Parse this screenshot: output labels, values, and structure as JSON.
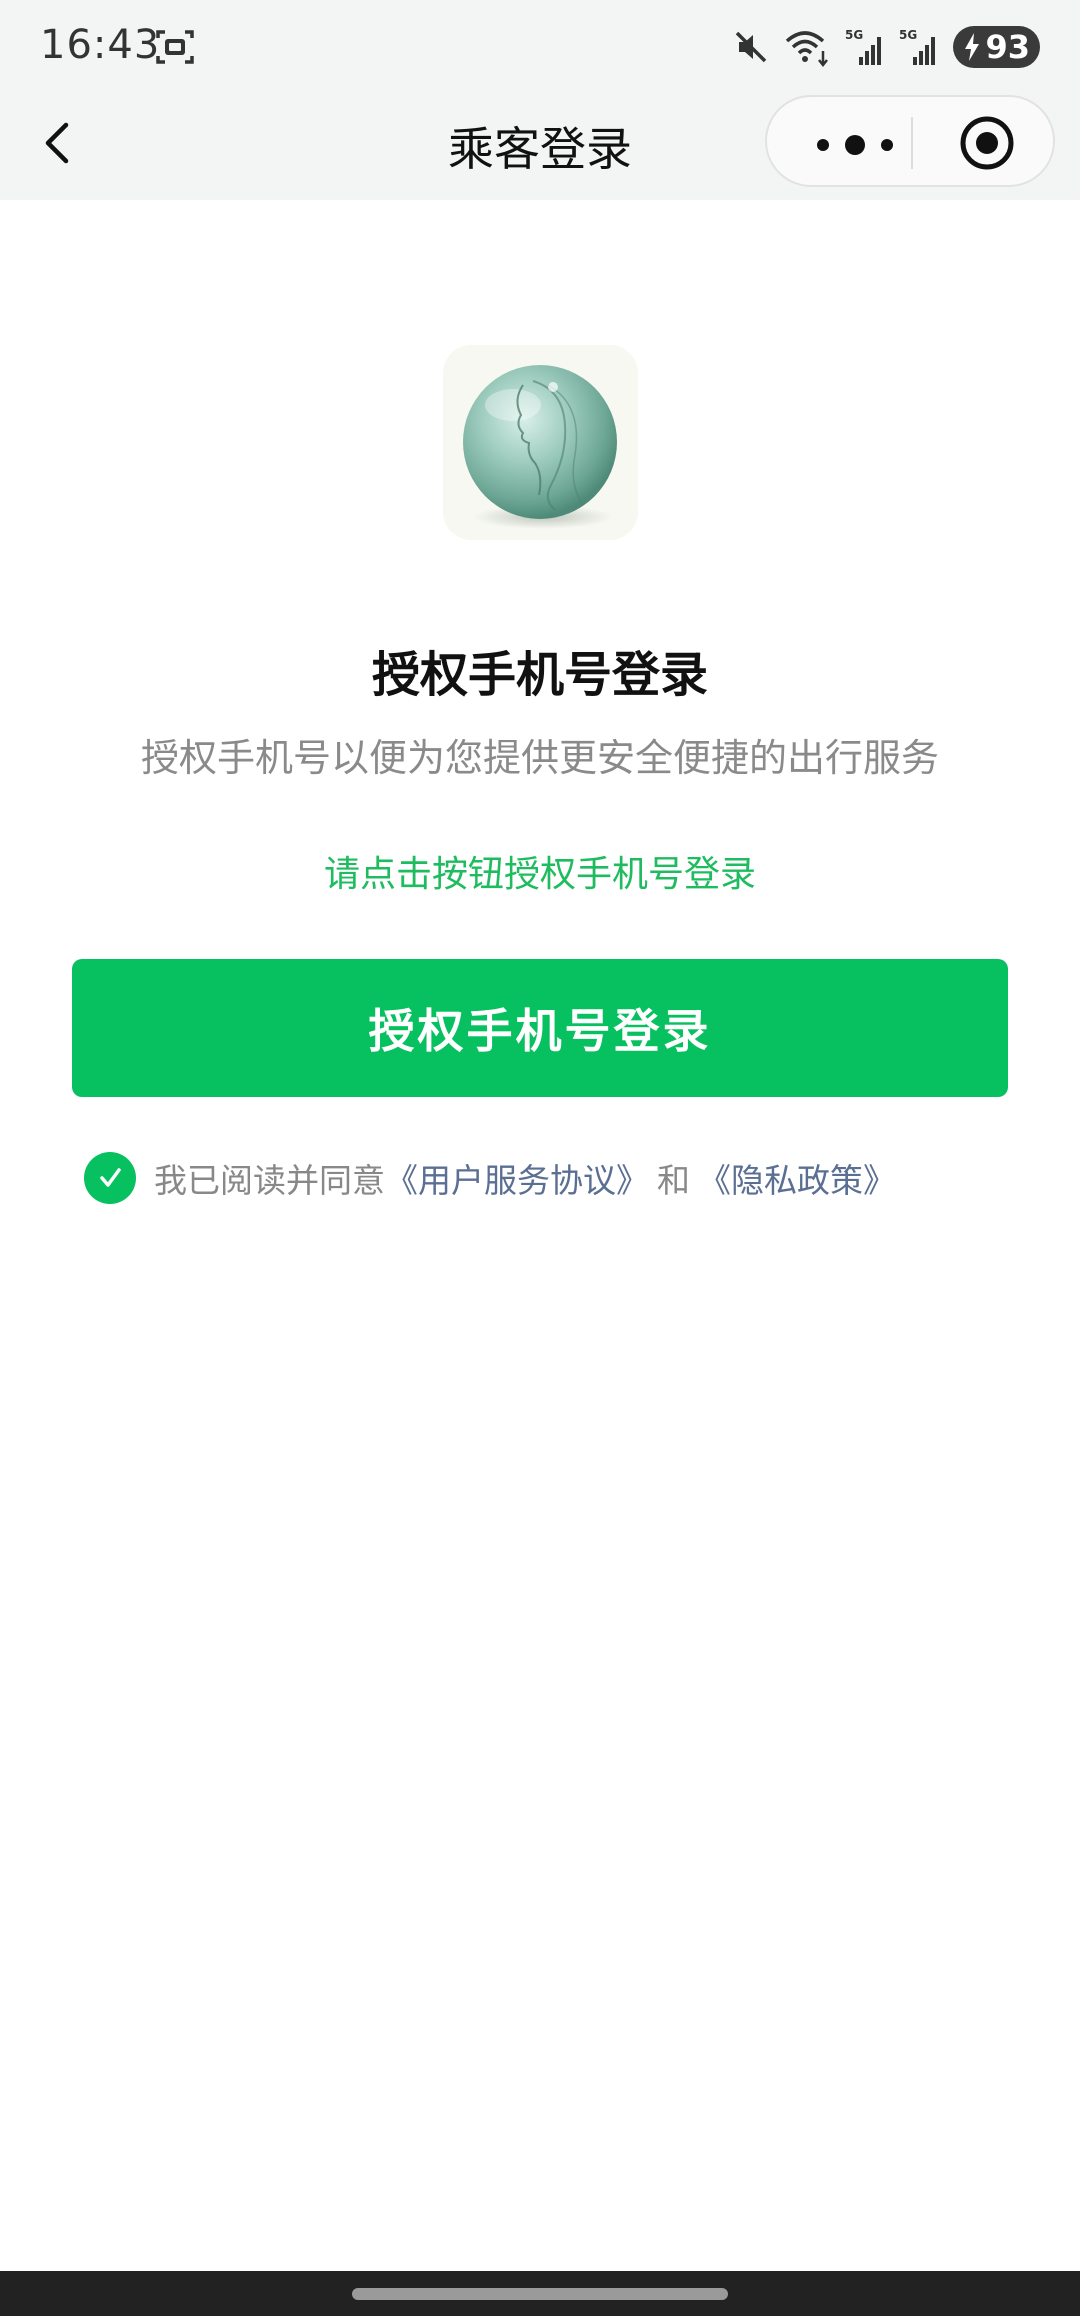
{
  "status_bar": {
    "time": "16:43",
    "battery": "93",
    "network_labels": [
      "5G",
      "5G"
    ],
    "icons": [
      "screen-record-icon",
      "mute-icon",
      "wifi-icon",
      "signal-icon",
      "signal-icon",
      "charging-battery-icon"
    ]
  },
  "nav": {
    "title": "乘客登录",
    "back_icon": "chevron-left-icon",
    "more_icon": "more-dots-icon",
    "close_icon": "target-circle-icon"
  },
  "main": {
    "heading": "授权手机号登录",
    "subtext": "授权手机号以便为您提供更安全便捷的出行服务",
    "hint": "请点击按钮授权手机号登录",
    "login_button": "授权手机号登录",
    "agreement": {
      "prefix": "我已阅读并同意",
      "user_agreement": "《用户服务协议》",
      "conjunction": "和",
      "privacy_policy": "《隐私政策》",
      "checked": true
    }
  },
  "colors": {
    "primary": "#07c160",
    "hint": "#1ebc5e",
    "link": "#5b6f93",
    "nav_bg": "#f3f5f4"
  }
}
